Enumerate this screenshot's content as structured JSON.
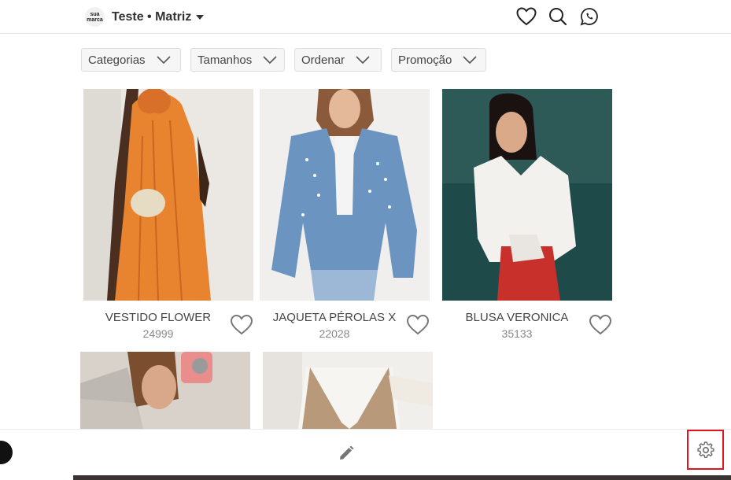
{
  "header": {
    "logo_text": "sua marca",
    "store_name": "Teste • Matriz"
  },
  "filters": [
    {
      "label": "Categorias"
    },
    {
      "label": "Tamanhos"
    },
    {
      "label": "Ordenar"
    },
    {
      "label": "Promoção"
    }
  ],
  "products": [
    {
      "name": "VESTIDO FLOWER",
      "code": "24999"
    },
    {
      "name": "JAQUETA PÉROLAS X",
      "code": "22028"
    },
    {
      "name": "BLUSA VERONICA",
      "code": "35133"
    }
  ],
  "colors": {
    "highlight_border": "#e0161e"
  }
}
